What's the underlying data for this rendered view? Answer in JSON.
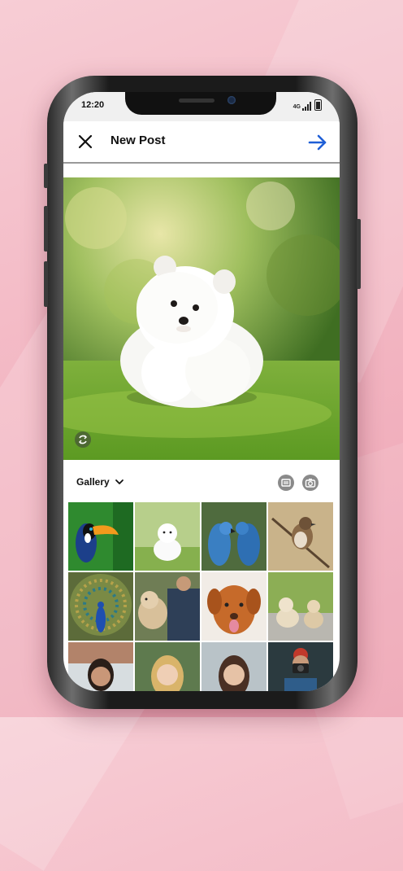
{
  "status_bar": {
    "time": "12:20",
    "network": "4G"
  },
  "header": {
    "title": "New Post",
    "close_icon": "close-icon",
    "next_icon": "arrow-right-icon"
  },
  "preview": {
    "subject": "white-puppy-photo",
    "rotate_icon": "rotate-icon"
  },
  "gallery": {
    "label": "Gallery",
    "dropdown_icon": "chevron-down-icon",
    "multi_select_icon": "multi-select-icon",
    "camera_icon": "camera-icon"
  },
  "thumbnails": [
    "toucan",
    "white-puppy",
    "parrots",
    "sparrow",
    "peacock",
    "man-with-dog",
    "brown-dog",
    "two-puppies",
    "woman-1",
    "woman-2",
    "woman-3",
    "man-camera"
  ],
  "colors": {
    "accent": "#1f5fd6",
    "icon_gray": "#8a8a8a",
    "background": "#f3b8c4"
  }
}
